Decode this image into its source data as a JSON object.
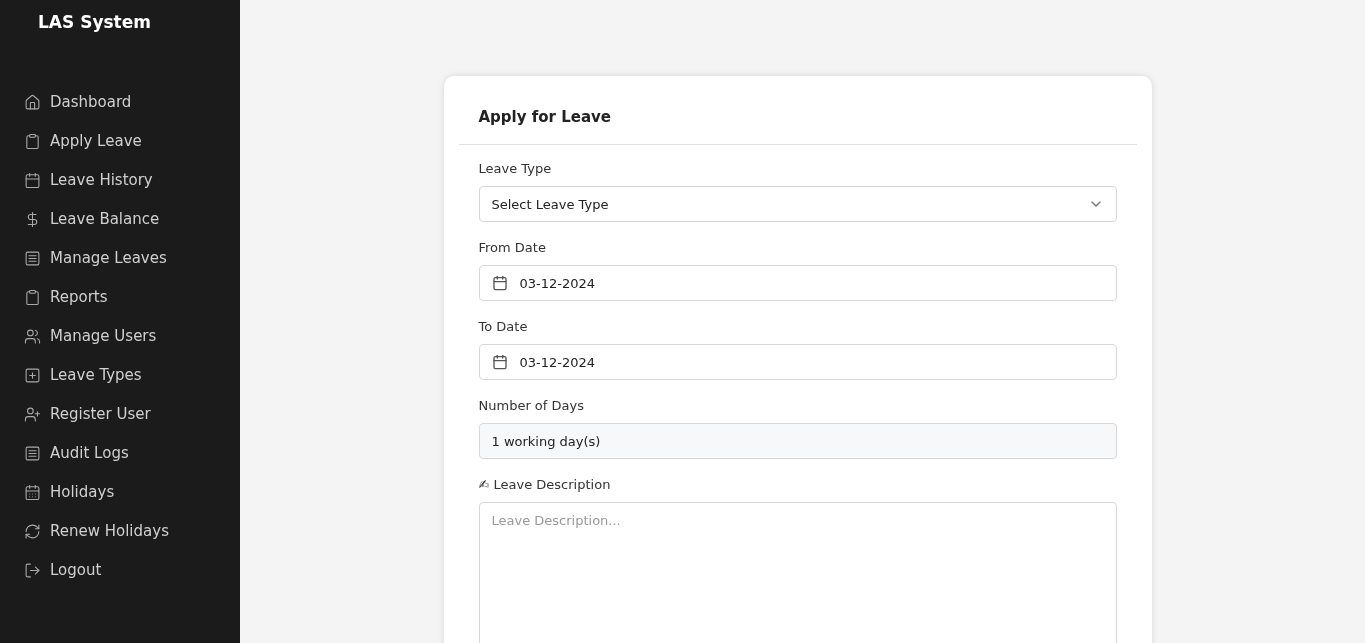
{
  "sidebar": {
    "title": "LAS System",
    "items": [
      {
        "label": "Dashboard"
      },
      {
        "label": "Apply Leave"
      },
      {
        "label": "Leave History"
      },
      {
        "label": "Leave Balance"
      },
      {
        "label": "Manage Leaves"
      },
      {
        "label": "Reports"
      },
      {
        "label": "Manage Users"
      },
      {
        "label": "Leave Types"
      },
      {
        "label": "Register User"
      },
      {
        "label": "Audit Logs"
      },
      {
        "label": "Holidays"
      },
      {
        "label": "Renew Holidays"
      },
      {
        "label": "Logout"
      }
    ]
  },
  "form": {
    "title": "Apply for Leave",
    "fields": [
      {
        "kind": "select",
        "label": "Leave Type",
        "placeholder": "Select Leave Type"
      },
      {
        "kind": "date",
        "label": "From Date",
        "value": "03-12-2024"
      },
      {
        "kind": "date",
        "label": "To Date",
        "value": "03-12-2024"
      },
      {
        "kind": "readonly",
        "label": "Number of Days",
        "value": "1 working day(s)"
      },
      {
        "kind": "textarea",
        "label": "✍ Leave Description",
        "placeholder": "Leave Description..."
      }
    ]
  }
}
